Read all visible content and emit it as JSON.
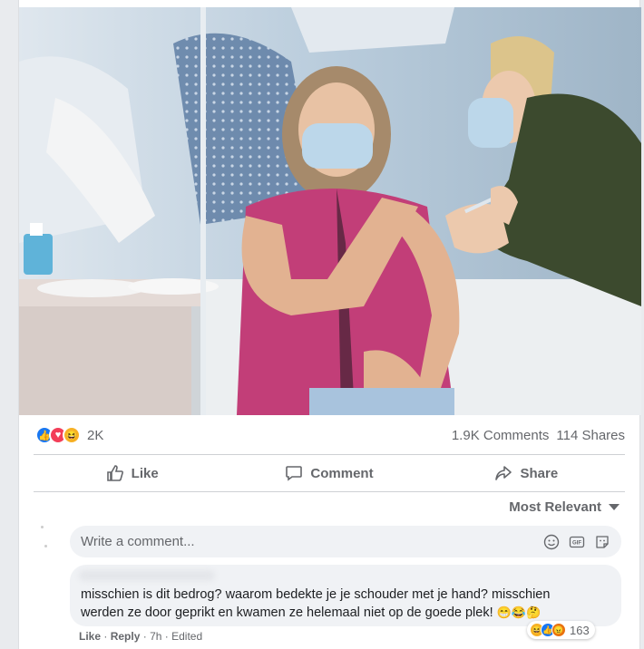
{
  "post": {
    "reaction_count": "2K",
    "comments": "1.9K Comments",
    "shares": "114 Shares",
    "reactions": [
      "like-icon",
      "love-icon",
      "haha-icon"
    ]
  },
  "actions": {
    "like": "Like",
    "comment": "Comment",
    "share": "Share"
  },
  "comments_section": {
    "sort_label": "Most Relevant",
    "write_placeholder": "Write a comment...",
    "toolbar_icons": [
      "emoji-icon",
      "gif-icon",
      "sticker-icon"
    ],
    "comment": {
      "text_line1": "misschien is dit bedrog? waarom bedekte je je schouder met je hand? misschien",
      "text_line2": "werden ze door geprikt en kwamen ze helemaal niet op de goede plek!",
      "text_emojis": "😁😂🤔",
      "reaction_count": "163",
      "reaction_icons": [
        "haha-icon",
        "like-icon",
        "angry-icon"
      ],
      "like_label": "Like",
      "reply_label": "Reply",
      "time": "7h",
      "edited": "Edited"
    }
  },
  "colors": {
    "accent": "#1877f2",
    "muted": "#65676b",
    "bubble": "#f0f2f5"
  }
}
